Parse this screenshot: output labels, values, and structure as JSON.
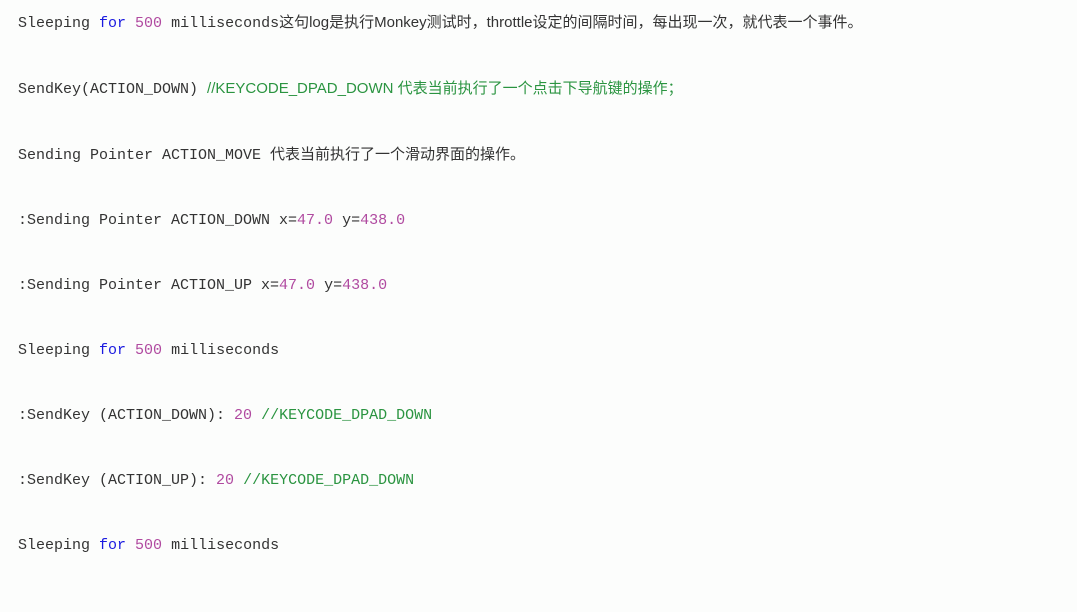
{
  "lines": {
    "l1": {
      "t1": "Sleeping ",
      "kw": "for",
      "sp": " ",
      "num": "500",
      "t2": " milliseconds",
      "cn": "这句log是执行Monkey测试时，throttle设定的间隔时间，每出现一次，就代表一个事件。"
    },
    "l2": {
      "t1": "SendKey(ACTION_DOWN) ",
      "cmt": "//KEYCODE_DPAD_DOWN 代表当前执行了一个点击下导航键的操作；"
    },
    "l3": {
      "t1": "Sending Pointer ACTION_MOVE ",
      "cn": "代表当前执行了一个滑动界面的操作。"
    },
    "l4": {
      "t1": ":Sending Pointer ACTION_DOWN x=",
      "n1": "47.0",
      "t2": " y=",
      "n2": "438.0"
    },
    "l5": {
      "t1": ":Sending Pointer ACTION_UP x=",
      "n1": "47.0",
      "t2": " y=",
      "n2": "438.0"
    },
    "l6": {
      "t1": "Sleeping ",
      "kw": "for",
      "sp": " ",
      "num": "500",
      "t2": " milliseconds"
    },
    "l7": {
      "t1": ":SendKey (ACTION_DOWN): ",
      "num": "20",
      "sp": " ",
      "cmt": "//KEYCODE_DPAD_DOWN"
    },
    "l8": {
      "t1": ":SendKey (ACTION_UP): ",
      "num": "20",
      "sp": " ",
      "cmt": "//KEYCODE_DPAD_DOWN"
    },
    "l9": {
      "t1": "Sleeping ",
      "kw": "for",
      "sp": " ",
      "num": "500",
      "t2": " milliseconds"
    }
  }
}
